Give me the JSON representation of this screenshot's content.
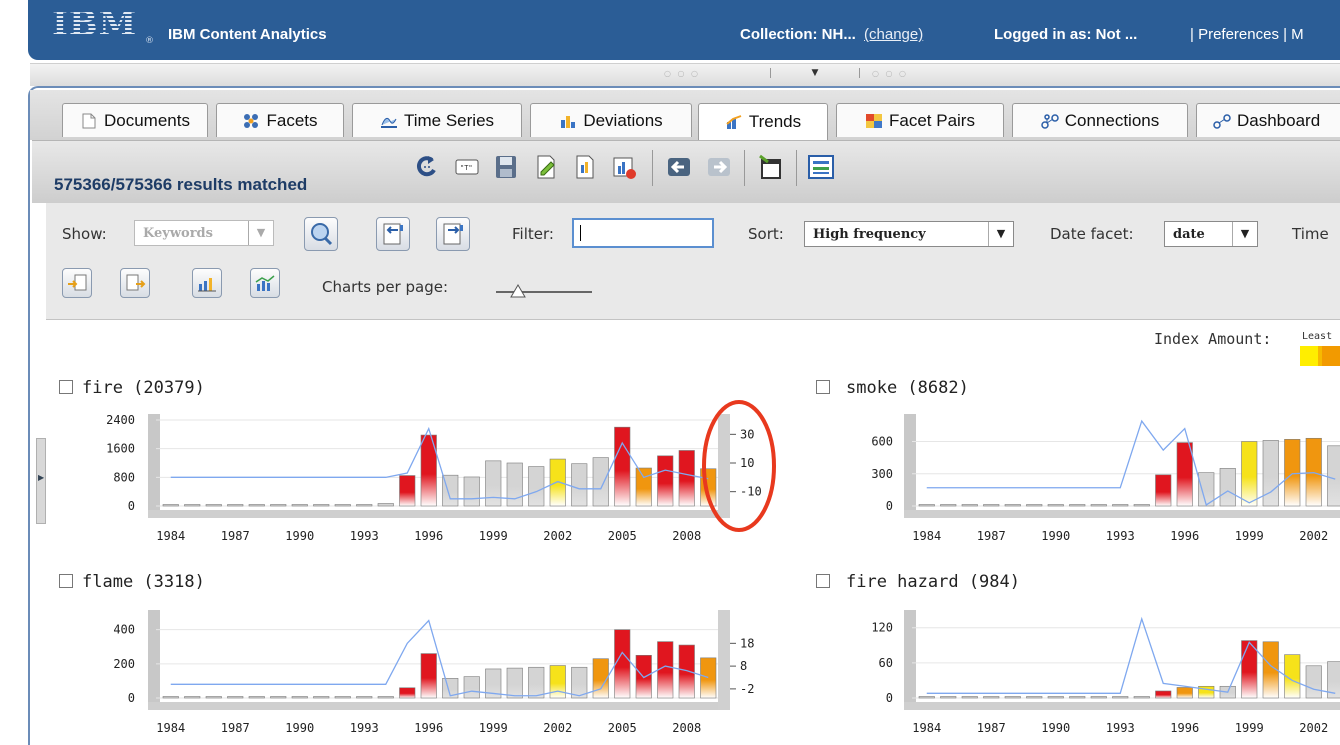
{
  "header": {
    "logo": "IBM",
    "app_name": "IBM Content Analytics",
    "collection": "Collection: NH...",
    "change_link": "(change)",
    "logged_in": "Logged in as: Not ...",
    "preferences": "| Preferences | M"
  },
  "tabs": [
    {
      "label": "Documents",
      "icon": "document-icon"
    },
    {
      "label": "Facets",
      "icon": "facets-icon"
    },
    {
      "label": "Time Series",
      "icon": "time-series-icon"
    },
    {
      "label": "Deviations",
      "icon": "deviations-icon"
    },
    {
      "label": "Trends",
      "icon": "trends-icon",
      "active": true
    },
    {
      "label": "Facet Pairs",
      "icon": "facet-pairs-icon"
    },
    {
      "label": "Connections",
      "icon": "connections-icon"
    },
    {
      "label": "Dashboard",
      "icon": "dashboard-icon"
    }
  ],
  "toolbar": {
    "results": "575366/575366 results matched",
    "icons": [
      "refresh-icon",
      "query-text-icon",
      "save-icon",
      "edit-icon",
      "export-icon",
      "report-icon",
      "back-icon",
      "forward-icon",
      "new-window-icon",
      "layout-icon"
    ]
  },
  "controls": {
    "show_label": "Show:",
    "show_value": "Keywords",
    "filter_label": "Filter:",
    "filter_value": "",
    "sort_label": "Sort:",
    "sort_value": "High frequency",
    "date_facet_label": "Date facet:",
    "date_facet_value": "date",
    "time_label": "Time",
    "charts_per_page_label": "Charts per page:",
    "index_amount_label": "Index Amount:",
    "index_amount_legend": "Least"
  },
  "colors": {
    "header_bg": "#2b5d96",
    "bar_gray": "#d4d4d4",
    "bar_yellow": "#f6e21a",
    "bar_orange": "#f0960f",
    "bar_red": "#e0161f",
    "line_blue": "#7fa8ef",
    "annotation_red": "#e8391e"
  },
  "chart_data": [
    {
      "type": "bar",
      "title": "fire (20379)",
      "categories": [
        "1984",
        "1985",
        "1986",
        "1987",
        "1988",
        "1989",
        "1990",
        "1991",
        "1992",
        "1993",
        "1994",
        "1995",
        "1996",
        "1997",
        "1998",
        "1999",
        "2000",
        "2001",
        "2002",
        "2003",
        "2004",
        "2005",
        "2006",
        "2007",
        "2008",
        "2009"
      ],
      "x_tick_labels": [
        "1984",
        "1987",
        "1990",
        "1993",
        "1996",
        "1999",
        "2002",
        "2005",
        "2008"
      ],
      "values": [
        30,
        25,
        20,
        25,
        30,
        30,
        30,
        30,
        30,
        40,
        70,
        850,
        1980,
        860,
        810,
        1260,
        1200,
        1100,
        1310,
        1180,
        1350,
        2200,
        1060,
        1400,
        1550,
        1040
      ],
      "bar_colors": [
        "gray",
        "gray",
        "gray",
        "gray",
        "gray",
        "gray",
        "gray",
        "gray",
        "gray",
        "gray",
        "gray",
        "red",
        "red",
        "gray",
        "gray",
        "gray",
        "gray",
        "gray",
        "yellow",
        "gray",
        "gray",
        "red",
        "orange",
        "red",
        "red",
        "orange"
      ],
      "ylim": [
        0,
        2400
      ],
      "y_ticks": [
        0,
        800,
        1600,
        2400
      ],
      "secondary_line": [
        0,
        0,
        0,
        0,
        0,
        0,
        0,
        0,
        0,
        0,
        0,
        3,
        34,
        -15,
        -15,
        -14,
        -15,
        -10,
        -3,
        -8,
        -8,
        24,
        0,
        5,
        2,
        -1
      ],
      "secondary_ylim": [
        -20,
        40
      ],
      "secondary_ticks": [
        -10,
        10,
        30
      ]
    },
    {
      "type": "bar",
      "title": "smoke (8682)",
      "categories": [
        "1984",
        "1985",
        "1986",
        "1987",
        "1988",
        "1989",
        "1990",
        "1991",
        "1992",
        "1993",
        "1994",
        "1995",
        "1996",
        "1997",
        "1998",
        "1999",
        "2000",
        "2001",
        "2002",
        "2003"
      ],
      "x_tick_labels": [
        "1984",
        "1987",
        "1990",
        "1993",
        "1996",
        "1999",
        "2002"
      ],
      "values": [
        10,
        10,
        10,
        10,
        10,
        10,
        10,
        10,
        10,
        10,
        10,
        290,
        590,
        310,
        350,
        600,
        610,
        620,
        630,
        560
      ],
      "bar_colors": [
        "gray",
        "gray",
        "gray",
        "gray",
        "gray",
        "gray",
        "gray",
        "gray",
        "gray",
        "gray",
        "gray",
        "red",
        "red",
        "gray",
        "gray",
        "yellow",
        "gray",
        "orange",
        "orange",
        "gray"
      ],
      "ylim": [
        0,
        800
      ],
      "y_ticks": [
        0,
        300,
        600
      ],
      "secondary_line": [
        170,
        170,
        170,
        170,
        170,
        170,
        170,
        170,
        170,
        170,
        790,
        520,
        720,
        10,
        140,
        30,
        130,
        300,
        310,
        250
      ]
    },
    {
      "type": "bar",
      "title": "flame (3318)",
      "categories": [
        "1984",
        "1985",
        "1986",
        "1987",
        "1988",
        "1989",
        "1990",
        "1991",
        "1992",
        "1993",
        "1994",
        "1995",
        "1996",
        "1997",
        "1998",
        "1999",
        "2000",
        "2001",
        "2002",
        "2003",
        "2004",
        "2005",
        "2006",
        "2007",
        "2008",
        "2009"
      ],
      "x_tick_labels": [
        "1984",
        "1987",
        "1990",
        "1993",
        "1996",
        "1999",
        "2002",
        "2005",
        "2008"
      ],
      "values": [
        5,
        5,
        5,
        5,
        5,
        5,
        5,
        5,
        5,
        5,
        5,
        60,
        260,
        115,
        125,
        170,
        175,
        180,
        190,
        180,
        230,
        400,
        250,
        330,
        310,
        235
      ],
      "bar_colors": [
        "gray",
        "gray",
        "gray",
        "gray",
        "gray",
        "gray",
        "gray",
        "gray",
        "gray",
        "gray",
        "gray",
        "red",
        "red",
        "gray",
        "gray",
        "gray",
        "gray",
        "gray",
        "yellow",
        "gray",
        "orange",
        "red",
        "red",
        "red",
        "red",
        "orange"
      ],
      "ylim": [
        0,
        480
      ],
      "y_ticks": [
        0,
        200,
        400
      ],
      "secondary_line": [
        0,
        0,
        0,
        0,
        0,
        0,
        0,
        0,
        0,
        0,
        0,
        18,
        28,
        -5,
        -3,
        -4,
        -5,
        -5,
        -3,
        -5,
        -2,
        14,
        3,
        8,
        6,
        3
      ],
      "secondary_ylim": [
        -6,
        30
      ],
      "secondary_ticks": [
        -2,
        8,
        18
      ]
    },
    {
      "type": "bar",
      "title": "fire hazard (984)",
      "categories": [
        "1984",
        "1985",
        "1986",
        "1987",
        "1988",
        "1989",
        "1990",
        "1991",
        "1992",
        "1993",
        "1994",
        "1995",
        "1996",
        "1997",
        "1998",
        "1999",
        "2000",
        "2001",
        "2002",
        "2003"
      ],
      "x_tick_labels": [
        "1984",
        "1987",
        "1990",
        "1993",
        "1996",
        "1999",
        "2002"
      ],
      "values": [
        2,
        2,
        2,
        2,
        2,
        2,
        2,
        2,
        2,
        2,
        2,
        12,
        18,
        20,
        20,
        98,
        96,
        74,
        55,
        62
      ],
      "bar_colors": [
        "gray",
        "gray",
        "gray",
        "gray",
        "gray",
        "gray",
        "gray",
        "gray",
        "gray",
        "gray",
        "gray",
        "red",
        "orange",
        "yellow",
        "gray",
        "red",
        "orange",
        "yellow",
        "gray",
        "gray"
      ],
      "ylim": [
        0,
        140
      ],
      "y_ticks": [
        0,
        60,
        120
      ],
      "secondary_line": [
        8,
        8,
        8,
        8,
        8,
        8,
        8,
        8,
        8,
        8,
        135,
        25,
        20,
        15,
        10,
        95,
        55,
        30,
        15,
        8
      ]
    }
  ]
}
